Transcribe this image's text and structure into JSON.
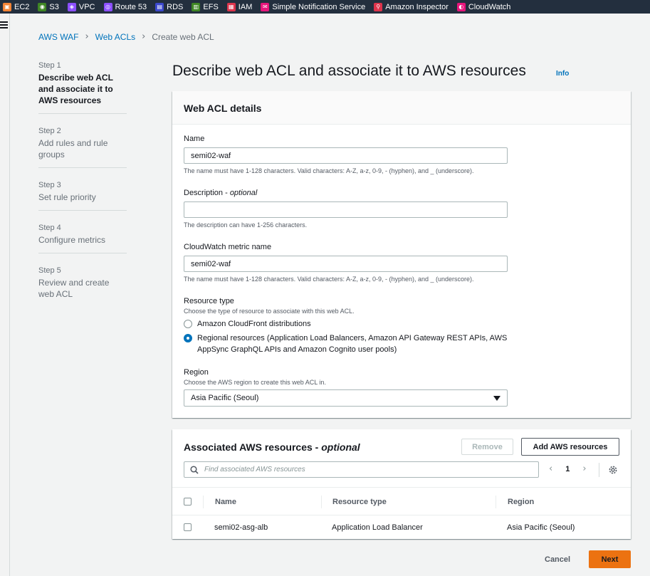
{
  "services_bar": [
    {
      "label": "EC2",
      "icon": "ec2-icon",
      "color": "#f58536"
    },
    {
      "label": "S3",
      "icon": "s3-icon",
      "color": "#3f8624"
    },
    {
      "label": "VPC",
      "icon": "vpc-icon",
      "color": "#8c4fff"
    },
    {
      "label": "Route 53",
      "icon": "route53-icon",
      "color": "#8c4fff"
    },
    {
      "label": "RDS",
      "icon": "rds-icon",
      "color": "#3b48cc"
    },
    {
      "label": "EFS",
      "icon": "efs-icon",
      "color": "#3f8624"
    },
    {
      "label": "IAM",
      "icon": "iam-icon",
      "color": "#dd344c"
    },
    {
      "label": "Simple Notification Service",
      "icon": "sns-icon",
      "color": "#e7157b"
    },
    {
      "label": "Amazon Inspector",
      "icon": "inspector-icon",
      "color": "#dd344c"
    },
    {
      "label": "CloudWatch",
      "icon": "cloudwatch-icon",
      "color": "#e7157b"
    }
  ],
  "breadcrumb": {
    "items": [
      "AWS WAF",
      "Web ACLs",
      "Create web ACL"
    ]
  },
  "steps": [
    {
      "num": "Step 1",
      "label": "Describe web ACL and associate it to AWS resources"
    },
    {
      "num": "Step 2",
      "label": "Add rules and rule groups"
    },
    {
      "num": "Step 3",
      "label": "Set rule priority"
    },
    {
      "num": "Step 4",
      "label": "Configure metrics"
    },
    {
      "num": "Step 5",
      "label": "Review and create web ACL"
    }
  ],
  "page": {
    "title": "Describe web ACL and associate it to AWS resources",
    "info": "Info"
  },
  "details": {
    "header": "Web ACL details",
    "name_label": "Name",
    "name_value": "semi02-waf",
    "name_desc": "The name must have 1-128 characters. Valid characters: A-Z, a-z, 0-9, - (hyphen), and _ (underscore).",
    "desc_label": "Description",
    "desc_optional": "optional",
    "desc_value": "",
    "desc_desc": "The description can have 1-256 characters.",
    "metric_label": "CloudWatch metric name",
    "metric_value": "semi02-waf",
    "metric_desc": "The name must have 1-128 characters. Valid characters: A-Z, a-z, 0-9, - (hyphen), and _ (underscore).",
    "resource_type_label": "Resource type",
    "resource_type_desc": "Choose the type of resource to associate with this web ACL.",
    "resource_option_1": "Amazon CloudFront distributions",
    "resource_option_2": "Regional resources (Application Load Balancers, Amazon API Gateway REST APIs, AWS AppSync GraphQL APIs and Amazon Cognito user pools)",
    "region_label": "Region",
    "region_desc": "Choose the AWS region to create this web ACL in.",
    "region_value": "Asia Pacific (Seoul)"
  },
  "resources": {
    "title": "Associated AWS resources",
    "title_optional": "optional",
    "remove_label": "Remove",
    "add_label": "Add AWS resources",
    "search_placeholder": "Find associated AWS resources",
    "page": "1",
    "columns": [
      "Name",
      "Resource type",
      "Region"
    ],
    "rows": [
      {
        "name": "semi02-asg-alb",
        "type": "Application Load Balancer",
        "region": "Asia Pacific (Seoul)"
      }
    ]
  },
  "footer": {
    "cancel_label": "Cancel",
    "next_label": "Next"
  }
}
